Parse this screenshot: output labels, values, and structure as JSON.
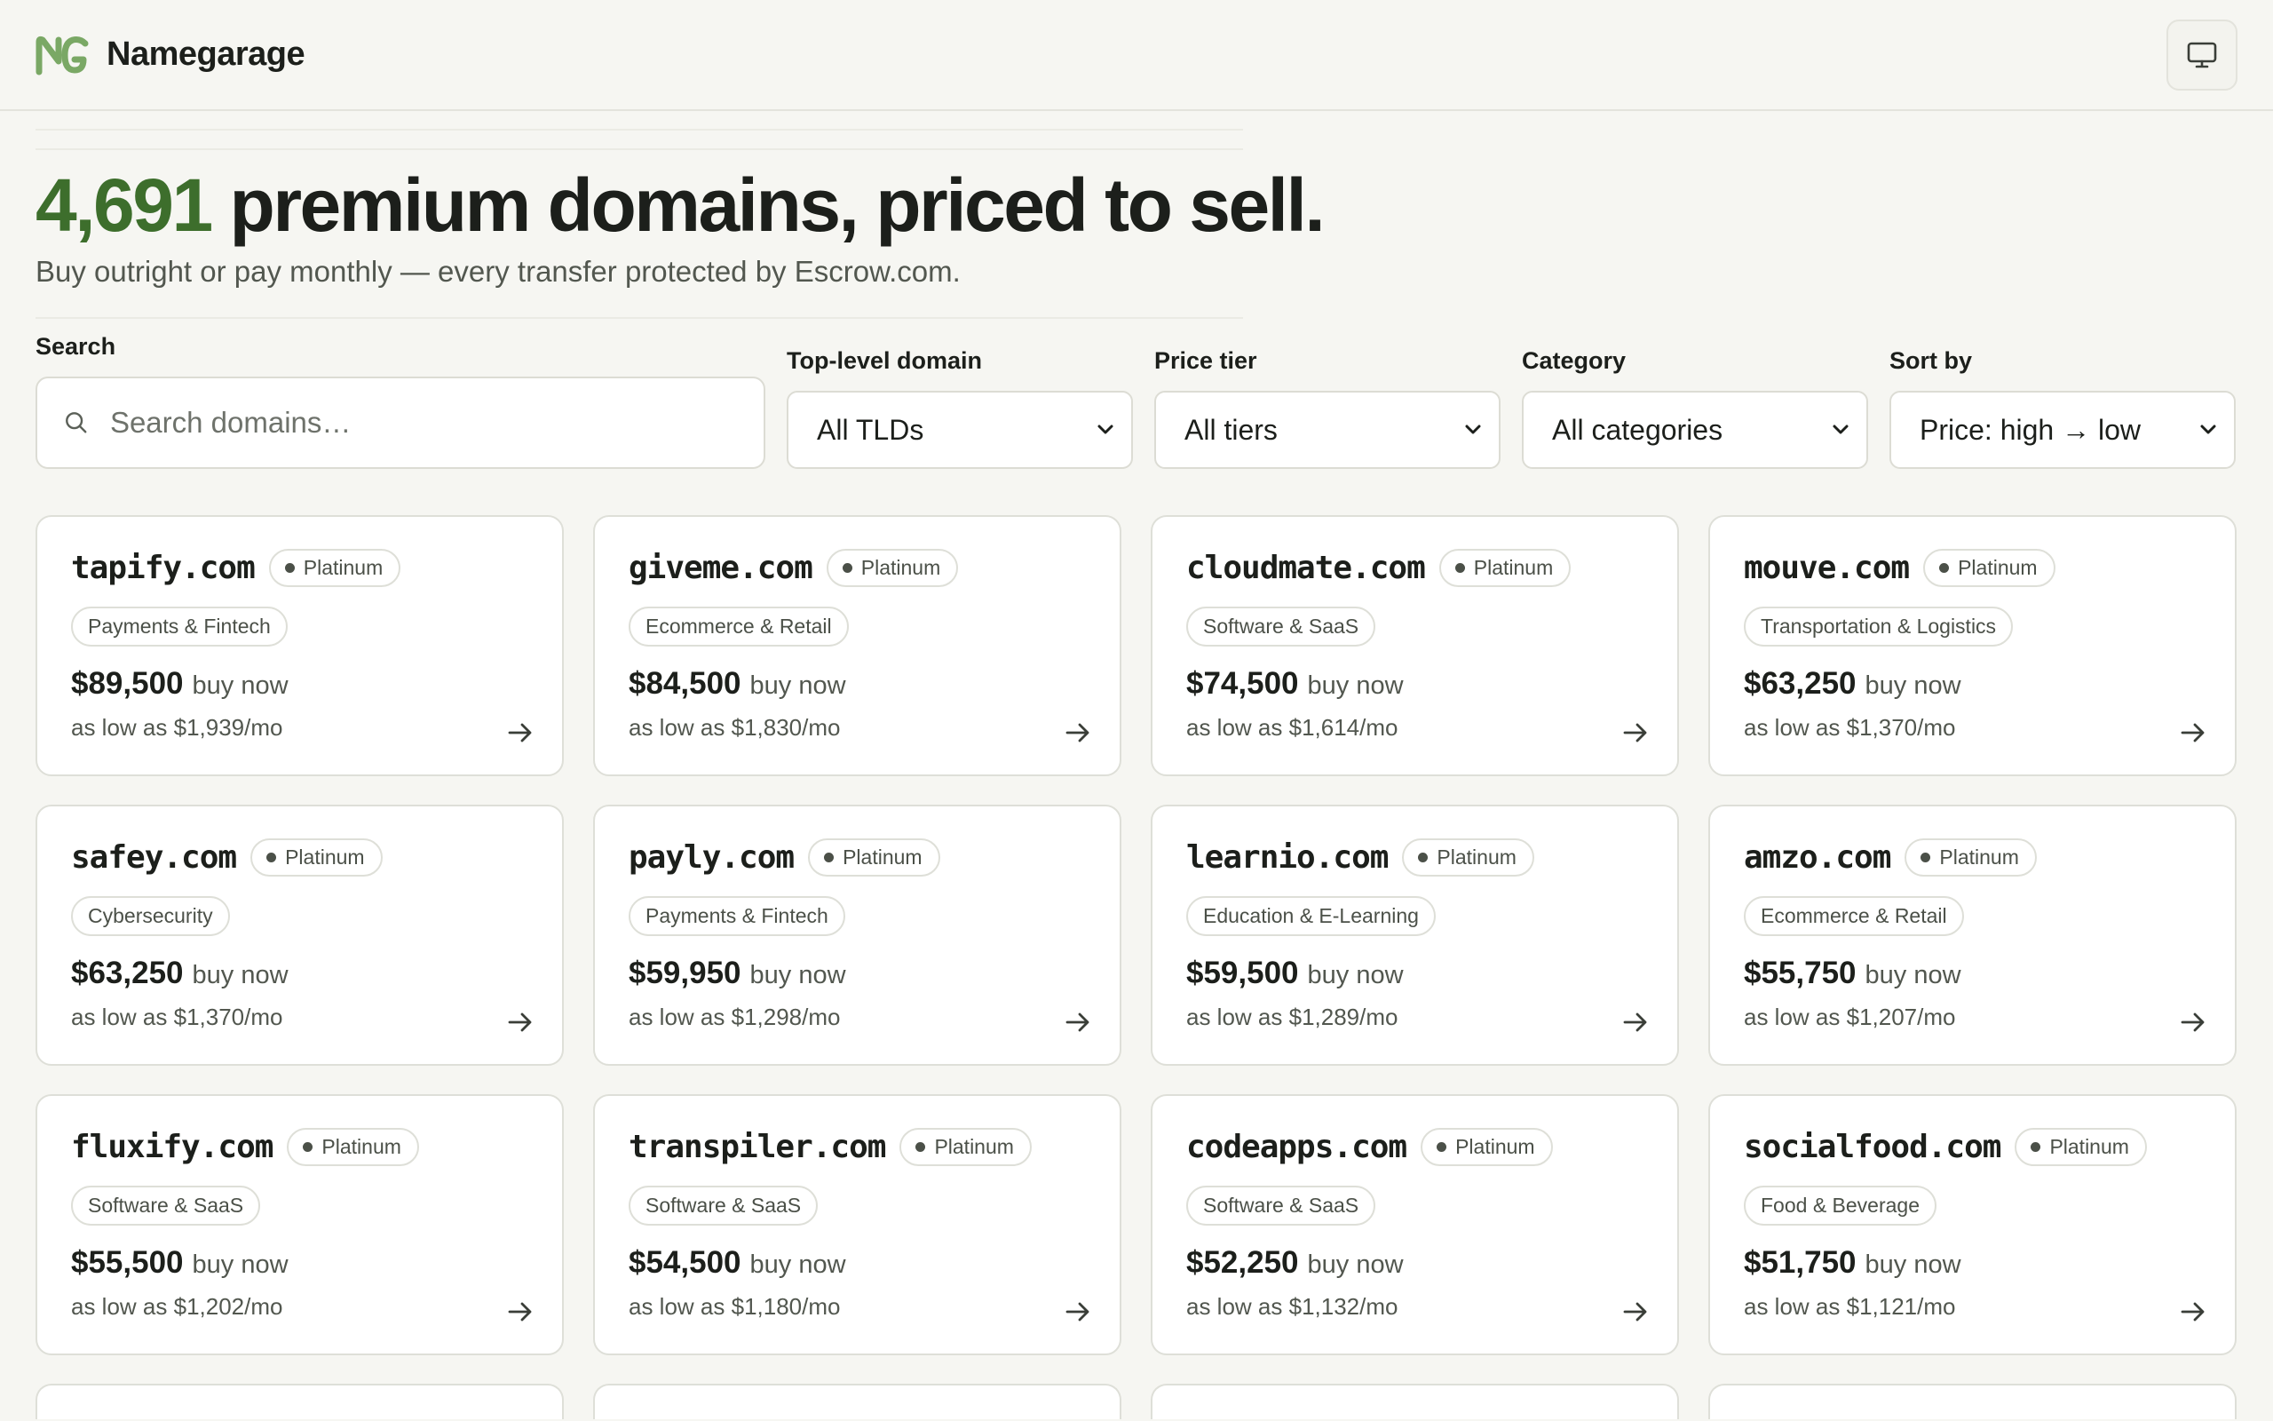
{
  "app": {
    "brand": "Namegarage"
  },
  "hero": {
    "count": "4,691",
    "headline_rest": " premium domains, priced to sell.",
    "subline": "Buy outright or pay monthly — every transfer protected by Escrow.com."
  },
  "filters": {
    "search_label": "Search",
    "search_placeholder": "Search domains…",
    "tld_label": "Top-level domain",
    "tld_value": "All TLDs",
    "tier_label": "Price tier",
    "tier_value": "All tiers",
    "category_label": "Category",
    "category_value": "All categories",
    "sort_label": "Sort by",
    "sort_value": "Price: high → low"
  },
  "labels": {
    "buy_now": "buy now"
  },
  "domains": [
    {
      "name": "tapify.com",
      "tier": "Platinum",
      "category": "Payments & Fintech",
      "price": "$89,500",
      "monthly": "as low as $1,939/mo"
    },
    {
      "name": "giveme.com",
      "tier": "Platinum",
      "category": "Ecommerce & Retail",
      "price": "$84,500",
      "monthly": "as low as $1,830/mo"
    },
    {
      "name": "cloudmate.com",
      "tier": "Platinum",
      "category": "Software & SaaS",
      "price": "$74,500",
      "monthly": "as low as $1,614/mo"
    },
    {
      "name": "mouve.com",
      "tier": "Platinum",
      "category": "Transportation & Logistics",
      "price": "$63,250",
      "monthly": "as low as $1,370/mo"
    },
    {
      "name": "safey.com",
      "tier": "Platinum",
      "category": "Cybersecurity",
      "price": "$63,250",
      "monthly": "as low as $1,370/mo"
    },
    {
      "name": "payly.com",
      "tier": "Platinum",
      "category": "Payments & Fintech",
      "price": "$59,950",
      "monthly": "as low as $1,298/mo"
    },
    {
      "name": "learnio.com",
      "tier": "Platinum",
      "category": "Education & E-Learning",
      "price": "$59,500",
      "monthly": "as low as $1,289/mo"
    },
    {
      "name": "amzo.com",
      "tier": "Platinum",
      "category": "Ecommerce & Retail",
      "price": "$55,750",
      "monthly": "as low as $1,207/mo"
    },
    {
      "name": "fluxify.com",
      "tier": "Platinum",
      "category": "Software & SaaS",
      "price": "$55,500",
      "monthly": "as low as $1,202/mo"
    },
    {
      "name": "transpiler.com",
      "tier": "Platinum",
      "category": "Software & SaaS",
      "price": "$54,500",
      "monthly": "as low as $1,180/mo"
    },
    {
      "name": "codeapps.com",
      "tier": "Platinum",
      "category": "Software & SaaS",
      "price": "$52,250",
      "monthly": "as low as $1,132/mo"
    },
    {
      "name": "socialfood.com",
      "tier": "Platinum",
      "category": "Food & Beverage",
      "price": "$51,750",
      "monthly": "as low as $1,121/mo"
    }
  ],
  "colors": {
    "accent": "#3d6e2c",
    "logo": "#7aa865",
    "background": "#f6f6f2"
  }
}
